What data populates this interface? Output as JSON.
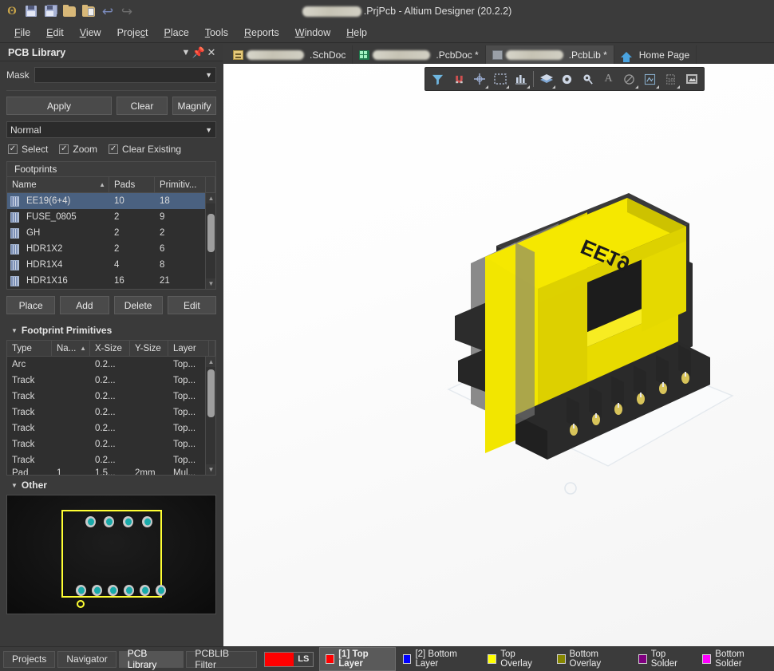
{
  "window": {
    "title_suffix": ".PrjPcb - Altium Designer (20.2.2)",
    "redacted_project_name": ""
  },
  "toolbar_icons": [
    {
      "name": "altium-logo-icon",
      "glyph": "ʘ"
    },
    {
      "name": "save-icon",
      "glyph": ""
    },
    {
      "name": "save-all-icon",
      "glyph": ""
    },
    {
      "name": "open-folder-icon",
      "glyph": ""
    },
    {
      "name": "open-project-icon",
      "glyph": ""
    },
    {
      "name": "undo-icon",
      "glyph": "↩"
    },
    {
      "name": "redo-icon",
      "glyph": "↪"
    }
  ],
  "menubar": {
    "items": [
      {
        "name": "file",
        "pre": "",
        "acc": "F",
        "post": "ile"
      },
      {
        "name": "edit",
        "pre": "",
        "acc": "E",
        "post": "dit"
      },
      {
        "name": "view",
        "pre": "",
        "acc": "V",
        "post": "iew"
      },
      {
        "name": "project",
        "pre": "Proje",
        "acc": "c",
        "post": "t"
      },
      {
        "name": "place",
        "pre": "",
        "acc": "P",
        "post": "lace"
      },
      {
        "name": "tools",
        "pre": "",
        "acc": "T",
        "post": "ools"
      },
      {
        "name": "reports",
        "pre": "",
        "acc": "R",
        "post": "eports"
      },
      {
        "name": "window",
        "pre": "",
        "acc": "W",
        "post": "indow"
      },
      {
        "name": "help",
        "pre": "",
        "acc": "H",
        "post": "elp"
      }
    ]
  },
  "panel": {
    "title": "PCB Library",
    "mask_label": "Mask",
    "mask_value": "",
    "buttons": {
      "apply": "Apply",
      "clear": "Clear",
      "magnify": "Magnify"
    },
    "mode_value": "Normal",
    "checkboxes": [
      {
        "label": "Select",
        "checked": true
      },
      {
        "label": "Zoom",
        "checked": true
      },
      {
        "label": "Clear Existing",
        "checked": true
      }
    ],
    "footprints": {
      "group_label": "Footprints",
      "columns": [
        "Name",
        "Pads",
        "Primitiv..."
      ],
      "sorted_column": "Name",
      "sort_direction": "asc",
      "rows": [
        {
          "name": "EE19(6+4)",
          "pads": "10",
          "primitives": "18",
          "selected": true
        },
        {
          "name": "FUSE_0805",
          "pads": "2",
          "primitives": "9",
          "selected": false
        },
        {
          "name": "GH",
          "pads": "2",
          "primitives": "2",
          "selected": false
        },
        {
          "name": "HDR1X2",
          "pads": "2",
          "primitives": "6",
          "selected": false
        },
        {
          "name": "HDR1X4",
          "pads": "4",
          "primitives": "8",
          "selected": false
        },
        {
          "name": "HDR1X16",
          "pads": "16",
          "primitives": "21",
          "selected": false
        }
      ]
    },
    "footprint_actions": [
      "Place",
      "Add",
      "Delete",
      "Edit"
    ],
    "primitives": {
      "section_label": "Footprint Primitives",
      "columns": [
        "Type",
        "Na...",
        "X-Size",
        "Y-Size",
        "Layer"
      ],
      "sorted_column": "Na...",
      "rows": [
        {
          "type": "Arc",
          "nam": "",
          "x": "0.2...",
          "y": "",
          "layer": "Top..."
        },
        {
          "type": "Track",
          "nam": "",
          "x": "0.2...",
          "y": "",
          "layer": "Top..."
        },
        {
          "type": "Track",
          "nam": "",
          "x": "0.2...",
          "y": "",
          "layer": "Top..."
        },
        {
          "type": "Track",
          "nam": "",
          "x": "0.2...",
          "y": "",
          "layer": "Top..."
        },
        {
          "type": "Track",
          "nam": "",
          "x": "0.2...",
          "y": "",
          "layer": "Top..."
        },
        {
          "type": "Track",
          "nam": "",
          "x": "0.2...",
          "y": "",
          "layer": "Top..."
        },
        {
          "type": "Track",
          "nam": "",
          "x": "0.2...",
          "y": "",
          "layer": "Top..."
        },
        {
          "type": "Pad",
          "nam": "1",
          "x": "1.5...",
          "y": "2mm",
          "layer": "Mul..."
        }
      ]
    },
    "other": {
      "section_label": "Other",
      "preview": {
        "outline_color": "#ffff33",
        "pad_ring_color": "#c9c9c9",
        "pad_hole_color": "#1aa9a9",
        "top_pads": 4,
        "bottom_pads": 6
      }
    }
  },
  "doc_tabs": [
    {
      "icon": "schematic-icon",
      "label": ".SchDoc",
      "active": false,
      "redacted": true
    },
    {
      "icon": "pcb-icon",
      "label": ".PcbDoc *",
      "active": false,
      "redacted": true
    },
    {
      "icon": "pcblib-icon",
      "label": ".PcbLib *",
      "active": true,
      "redacted": true
    },
    {
      "icon": "home-icon",
      "label": "Home Page",
      "active": false,
      "redacted": false
    }
  ],
  "viewport_toolbar": [
    {
      "name": "filter-icon",
      "caret": false
    },
    {
      "name": "magnet-snap-icon",
      "caret": false
    },
    {
      "name": "crosshair-icon",
      "caret": true
    },
    {
      "name": "selection-rect-icon",
      "caret": true
    },
    {
      "name": "board-insight-icon",
      "caret": true
    },
    {
      "name": "layer-stack-icon",
      "caret": true
    },
    {
      "name": "via-icon",
      "caret": false
    },
    {
      "name": "pad-icon",
      "caret": false
    },
    {
      "name": "text-icon",
      "caret": false
    },
    {
      "name": "arc-icon",
      "caret": true
    },
    {
      "name": "dimension-icon",
      "caret": true
    },
    {
      "name": "ruler-icon",
      "caret": true
    },
    {
      "name": "image-region-icon",
      "caret": false
    }
  ],
  "model_3d": {
    "part_label": "EE19",
    "bobbin_color": "#f2e600",
    "core_color": "#2b2b2b",
    "clip_color": "#808080",
    "pin_color": "#d8c45a"
  },
  "bottom": {
    "panel_tabs": [
      {
        "label": "Projects",
        "active": false
      },
      {
        "label": "Navigator",
        "active": false
      },
      {
        "label": "PCB Library",
        "active": true
      },
      {
        "label": "PCBLIB Filter",
        "active": false
      }
    ],
    "layer_set": {
      "label": "LS",
      "color": "#ff0000"
    },
    "layers": [
      {
        "label": "[1] Top Layer",
        "color": "#ff0000",
        "active": true
      },
      {
        "label": "[2] Bottom Layer",
        "color": "#0000ff",
        "active": false
      },
      {
        "label": "Top Overlay",
        "color": "#ffff00",
        "active": false
      },
      {
        "label": "Bottom Overlay",
        "color": "#868600",
        "active": false
      },
      {
        "label": "Top Solder",
        "color": "#800080",
        "active": false
      },
      {
        "label": "Bottom Solder",
        "color": "#ff00ff",
        "active": false
      }
    ]
  }
}
